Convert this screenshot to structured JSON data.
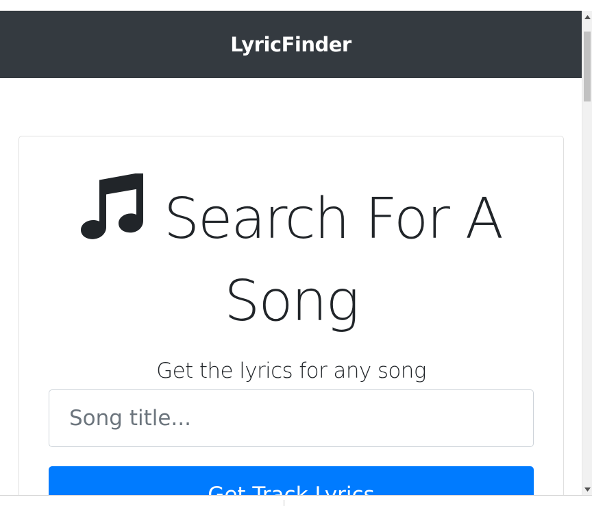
{
  "navbar": {
    "brand": "LyricFinder"
  },
  "search_card": {
    "icon": "music-note-icon",
    "title_line1": "Search For A",
    "title_line2": "Song",
    "subtitle": "Get the lyrics for any song",
    "input": {
      "value": "",
      "placeholder": "Song title..."
    },
    "submit_label": "Get Track Lyrics"
  },
  "colors": {
    "navbar_bg": "#343a40",
    "primary_button": "#007bff",
    "text": "#212529"
  }
}
